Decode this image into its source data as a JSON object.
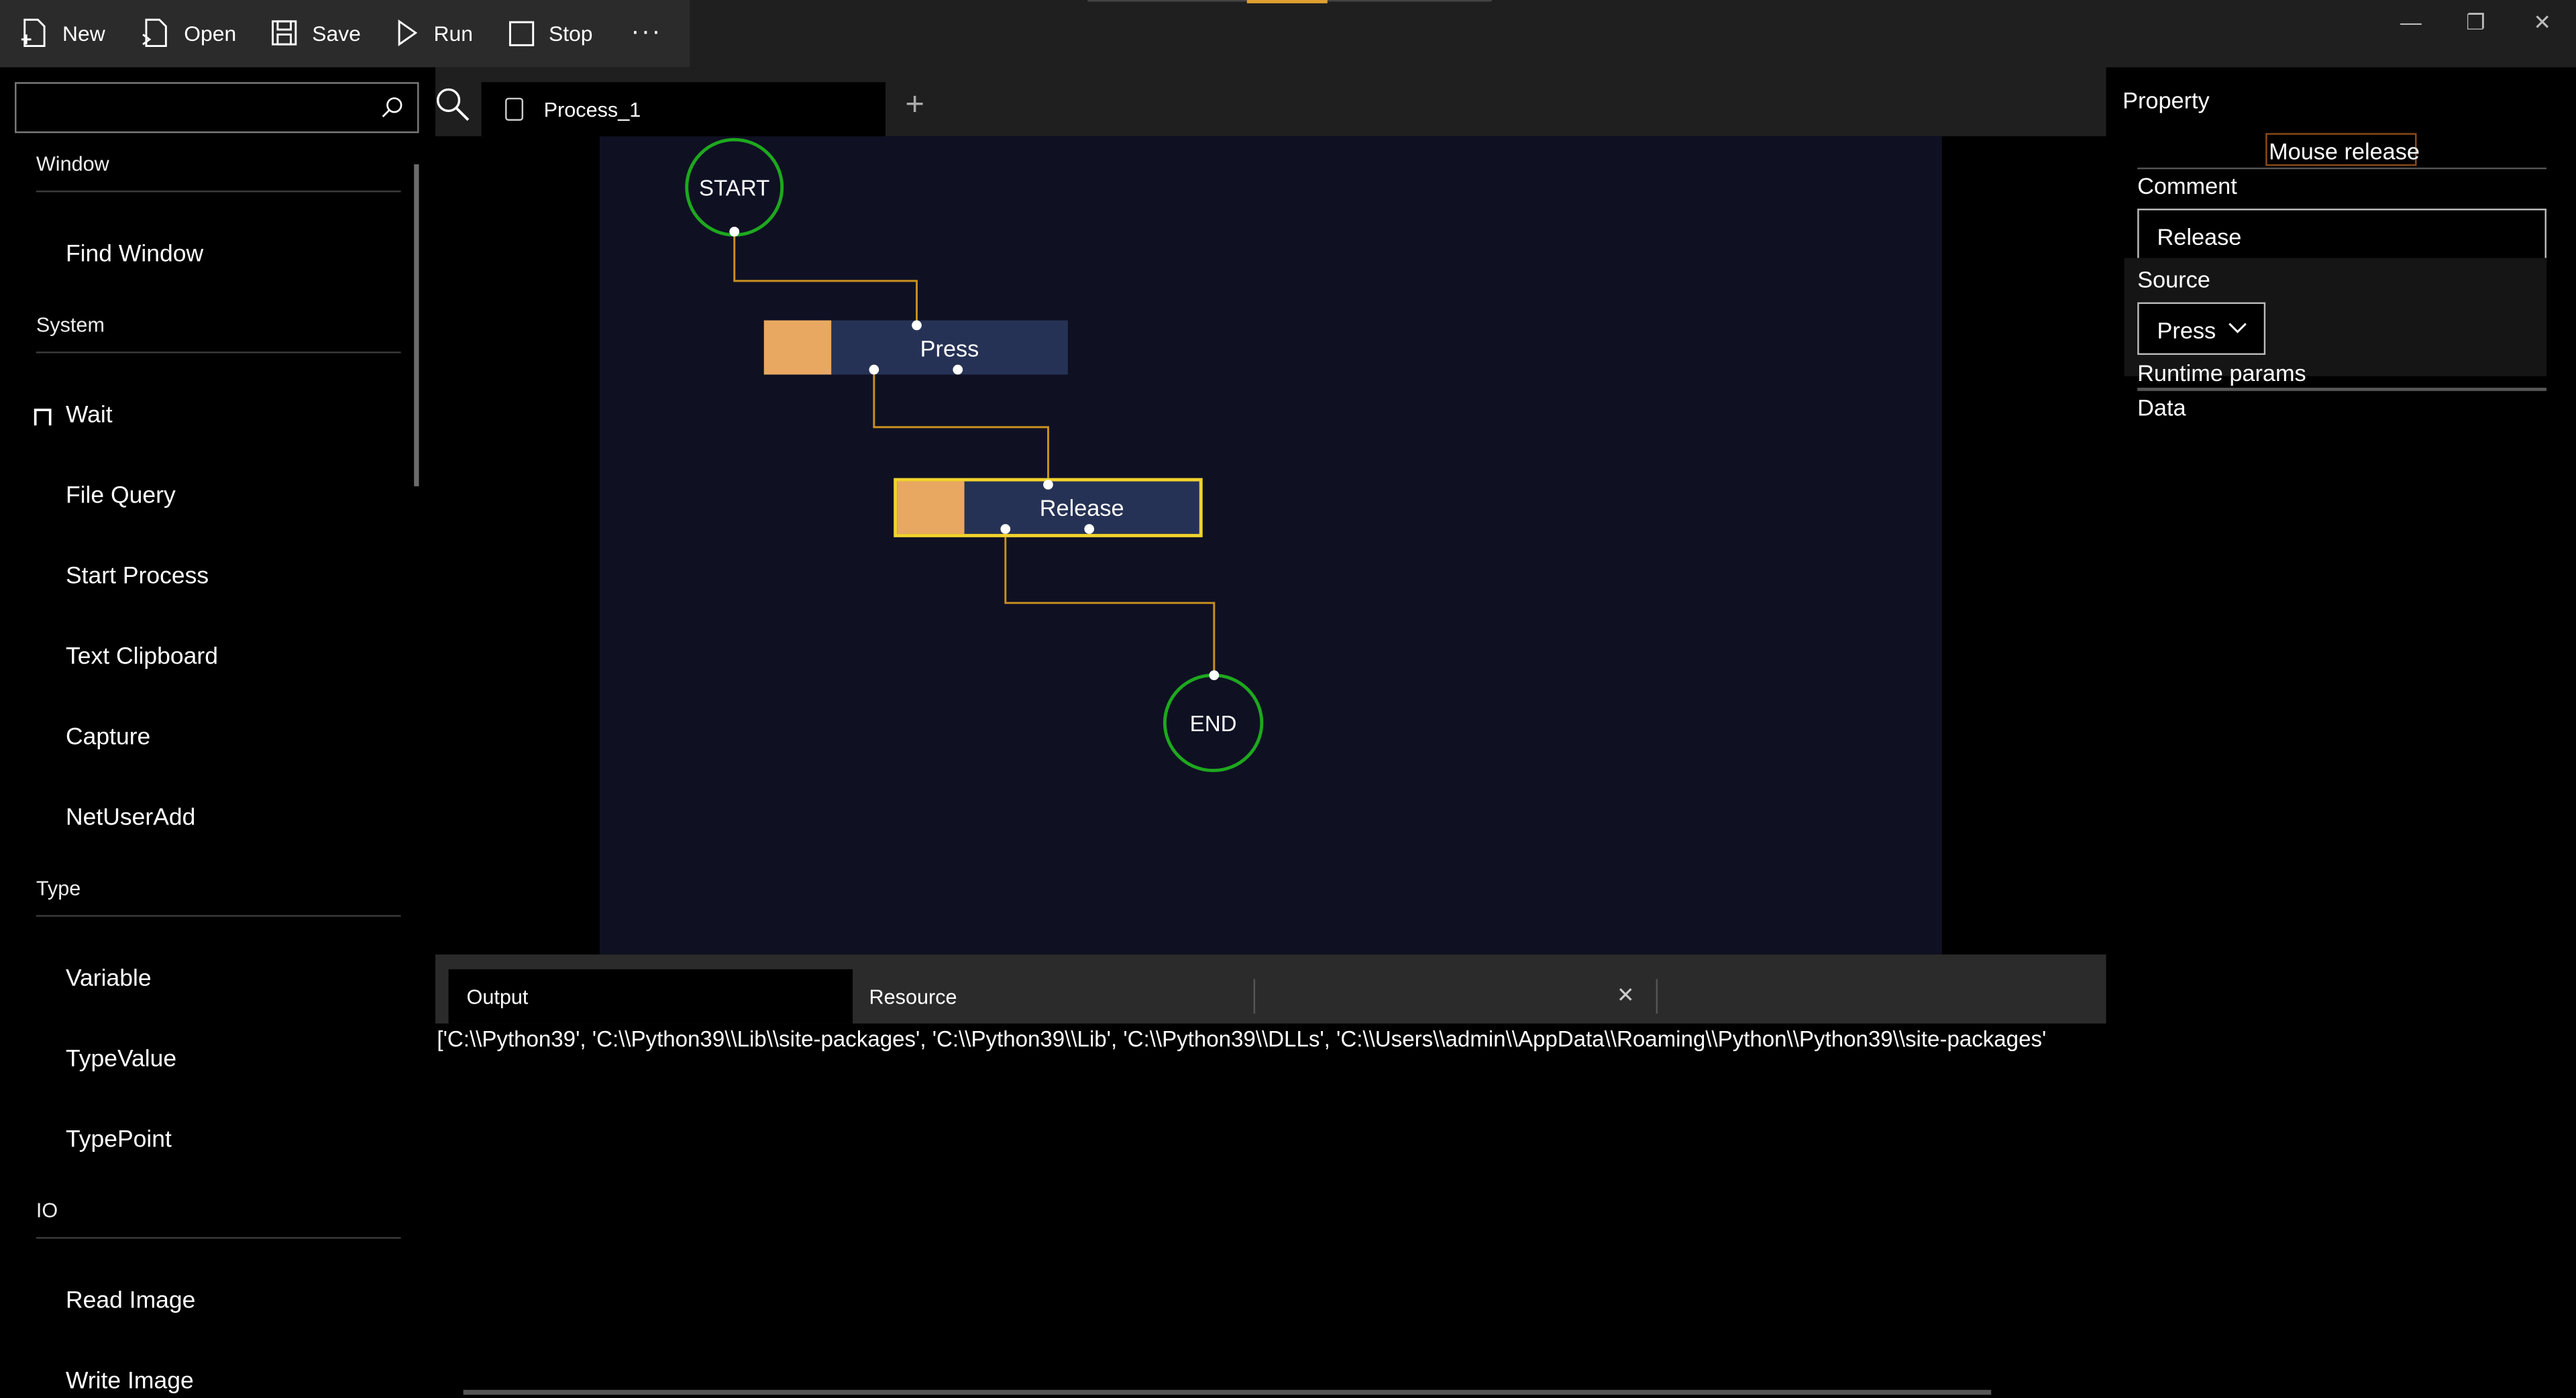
{
  "toolbar": {
    "new_label": "New",
    "open_label": "Open",
    "save_label": "Save",
    "run_label": "Run",
    "stop_label": "Stop",
    "more_label": "···"
  },
  "window_controls": {
    "minimize": "—",
    "restore": "❐",
    "close": "✕"
  },
  "search": {
    "value": "",
    "placeholder": ""
  },
  "sidebar": {
    "categories": [
      {
        "name": "Window",
        "items": [
          "Find Window"
        ]
      },
      {
        "name": "System",
        "items": [
          "Wait",
          "File Query",
          "Start Process",
          "Text Clipboard",
          "Capture",
          "NetUserAdd"
        ]
      },
      {
        "name": "Type",
        "items": [
          "Variable",
          "TypeValue",
          "TypePoint"
        ]
      },
      {
        "name": "IO",
        "items": [
          "Read Image",
          "Write Image"
        ]
      }
    ]
  },
  "tabs": {
    "active_label": "Process_1",
    "add_label": "+"
  },
  "flow": {
    "start_label": "START",
    "end_label": "END",
    "nodes": [
      {
        "label": "Press",
        "selected": false
      },
      {
        "label": "Release",
        "selected": true
      }
    ],
    "colors": {
      "canvas": "#0f1123",
      "node": "#263255",
      "swatch": "#e9a862",
      "selection": "#f2d32b",
      "wire": "#c9901f",
      "terminal_border": "#1ea81e"
    }
  },
  "output": {
    "tab_output": "Output",
    "tab_resource": "Resource",
    "close_label": "✕",
    "text": "['C:\\\\Python39', 'C:\\\\Python39\\\\Lib\\\\site-packages', 'C:\\\\Python39\\\\Lib', 'C:\\\\Python39\\\\DLLs', 'C:\\\\Users\\\\admin\\\\AppData\\\\Roaming\\\\Python\\\\Python39\\\\site-packages'"
  },
  "property": {
    "title": "Property",
    "node_title": "Mouse release",
    "comment_label": "Comment",
    "comment_value": "Release",
    "source_label": "Source",
    "source_value": "Press",
    "runtime_params_label": "Runtime params",
    "data_label": "Data"
  }
}
